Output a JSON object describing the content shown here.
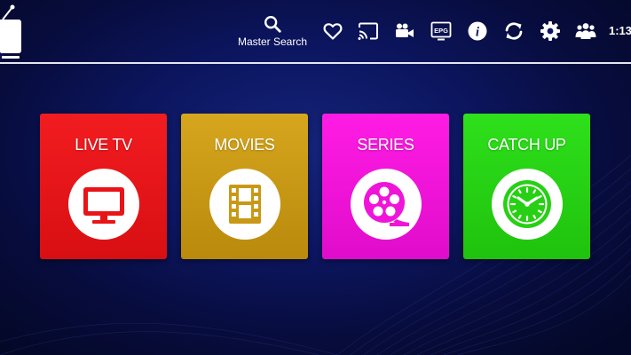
{
  "header": {
    "search_label": "Master Search",
    "clock": "1:13",
    "icons": [
      "search-icon",
      "heart-icon",
      "cast-icon",
      "video-camera-icon",
      "epg-icon",
      "info-icon",
      "refresh-icon",
      "gear-icon",
      "users-icon"
    ],
    "epg_icon_text": "EPG",
    "info_icon_text": "i"
  },
  "tiles": [
    {
      "label": "LIVE TV",
      "icon": "tv-icon",
      "color": "#e81418"
    },
    {
      "label": "MOVIES",
      "icon": "film-strip-icon",
      "color": "#c99814"
    },
    {
      "label": "SERIES",
      "icon": "film-reel-icon",
      "color": "#f014d8"
    },
    {
      "label": "CATCH UP",
      "icon": "clock-icon",
      "color": "#27d014"
    }
  ],
  "colors": {
    "background": "#0c1660",
    "divider": "#e4e6f0",
    "text": "#ffffff"
  }
}
